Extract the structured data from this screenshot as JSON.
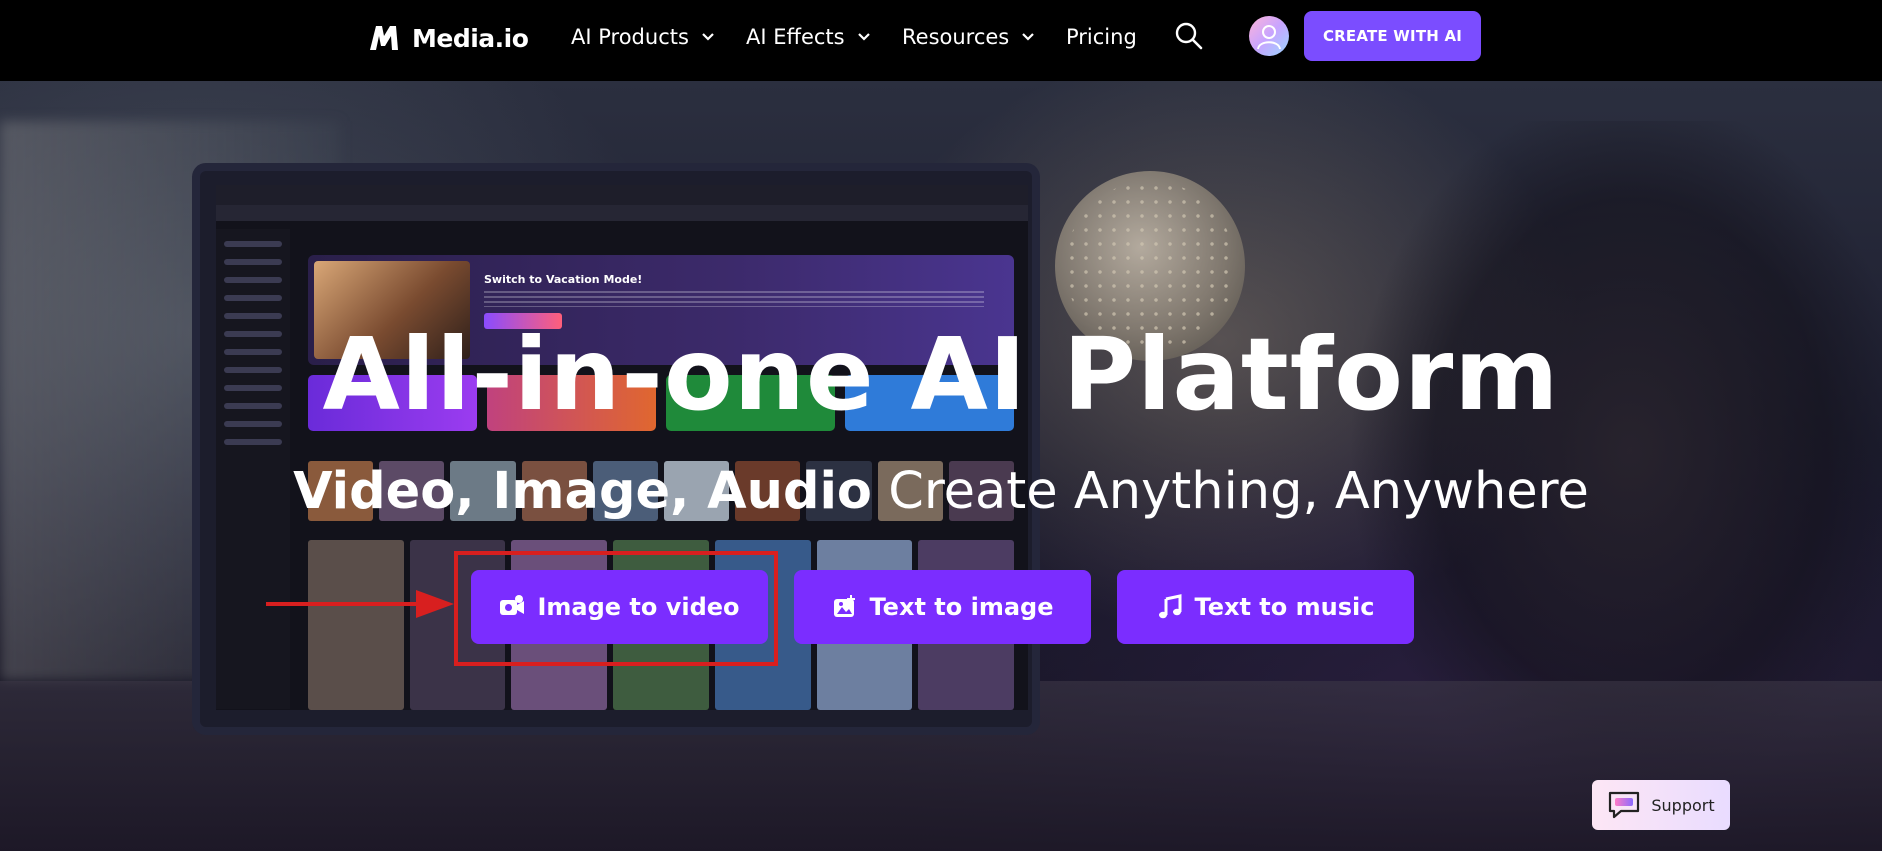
{
  "nav": {
    "logo_text": "Media.io",
    "items": [
      {
        "label": "AI Products",
        "has_dropdown": true
      },
      {
        "label": "AI Effects",
        "has_dropdown": true
      },
      {
        "label": "Resources",
        "has_dropdown": true
      },
      {
        "label": "Pricing",
        "has_dropdown": false
      }
    ],
    "cta_label": "CREATE WITH AI"
  },
  "monitor": {
    "banner_title": "Switch to Vacation Mode!"
  },
  "hero": {
    "title": "All-in-one AI Platform",
    "subtitle_bold": "Video, Image, Audio",
    "subtitle_regular": "Create Anything, Anywhere",
    "buttons": [
      {
        "label": "Image to video",
        "icon": "video-plus-icon"
      },
      {
        "label": "Text to image",
        "icon": "image-plus-icon"
      },
      {
        "label": "Text to music",
        "icon": "music-note-icon"
      }
    ]
  },
  "support": {
    "label": "Support"
  },
  "colors": {
    "nav_bg": "#000000",
    "accent_purple": "#7b2dff",
    "cta_purple": "#7b4dff",
    "highlight_red": "#d81f1f"
  }
}
